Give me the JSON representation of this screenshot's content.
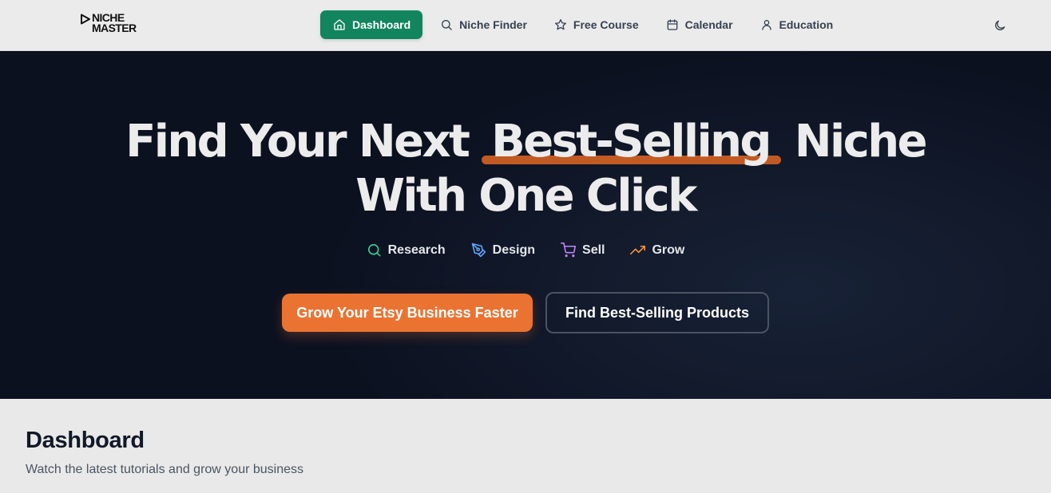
{
  "brand": {
    "line1": "NICHE",
    "line2": "MASTER"
  },
  "nav": {
    "items": [
      {
        "label": "Dashboard",
        "icon": "home-icon",
        "active": true
      },
      {
        "label": "Niche Finder",
        "icon": "search-icon",
        "active": false
      },
      {
        "label": "Free Course",
        "icon": "star-icon",
        "active": false
      },
      {
        "label": "Calendar",
        "icon": "calendar-icon",
        "active": false
      },
      {
        "label": "Education",
        "icon": "user-icon",
        "active": false
      }
    ],
    "theme_toggle_icon": "moon-icon"
  },
  "hero": {
    "title_part1": "Find Your Next",
    "title_highlight": "Best-Selling",
    "title_part2": "Niche",
    "title_line2": "With One Click",
    "features": [
      {
        "label": "Research",
        "icon": "search-icon",
        "color": "#34d399"
      },
      {
        "label": "Design",
        "icon": "pen-tool-icon",
        "color": "#60a5fa"
      },
      {
        "label": "Sell",
        "icon": "shopping-cart-icon",
        "color": "#c084fc"
      },
      {
        "label": "Grow",
        "icon": "trending-up-icon",
        "color": "#fb923c"
      }
    ],
    "primary_cta": "Grow Your Etsy Business Faster",
    "secondary_cta": "Find Best-Selling Products"
  },
  "dashboard": {
    "title": "Dashboard",
    "subtitle": "Watch the latest tutorials and grow your business"
  },
  "colors": {
    "accent_green": "#12855f",
    "accent_orange": "#ea7332",
    "highlight_underline": "#c25a23",
    "hero_bg": "#0c1120"
  }
}
